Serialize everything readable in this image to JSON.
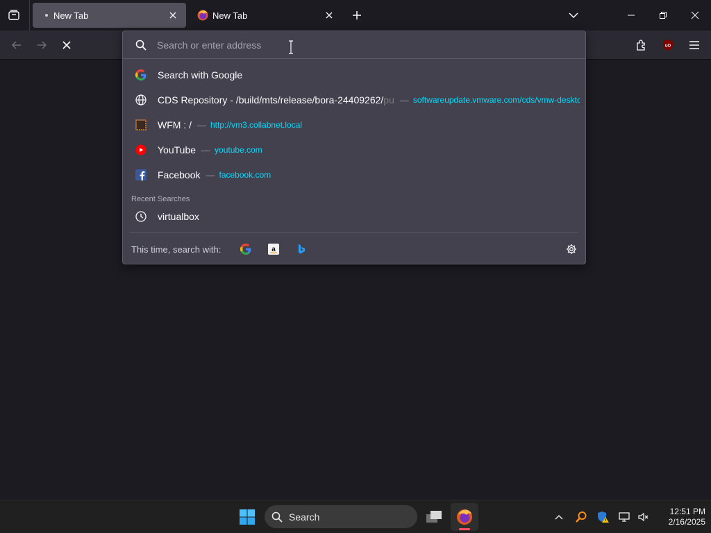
{
  "tabs": [
    {
      "title": "New Tab",
      "state": "active"
    },
    {
      "title": "New Tab",
      "state": "loading"
    }
  ],
  "address_bar": {
    "placeholder": "Search or enter address",
    "value": ""
  },
  "suggestions": [
    {
      "icon": "google-icon",
      "title": "Search with Google",
      "sep": "",
      "url": ""
    },
    {
      "icon": "globe-icon",
      "title": "CDS Repository - /build/mts/release/bora-24409262/",
      "title_fade": "pu",
      "sep": "—",
      "url": "softwareupdate.vmware.com/cds/vmw-deskto"
    },
    {
      "icon": "wfm-icon",
      "title": "WFM : /",
      "sep": "—",
      "url": "http://vm3.collabnet.local"
    },
    {
      "icon": "youtube-icon",
      "title": "YouTube",
      "sep": "—",
      "url": "youtube.com"
    },
    {
      "icon": "facebook-icon",
      "title": "Facebook",
      "sep": "—",
      "url": "facebook.com"
    }
  ],
  "recent_searches": {
    "label": "Recent Searches",
    "items": [
      {
        "icon": "history-icon",
        "title": "virtualbox"
      }
    ]
  },
  "one_off": {
    "label": "This time, search with:",
    "engines": [
      "google-icon",
      "amazon-icon",
      "bing-icon"
    ]
  },
  "taskbar": {
    "search_label": "Search",
    "time": "12:51 PM",
    "date": "2/16/2025"
  },
  "colors": {
    "accent_url": "#00ddff",
    "panel": "#42414d",
    "toolbar": "#2b2a33",
    "background": "#1c1b22"
  }
}
